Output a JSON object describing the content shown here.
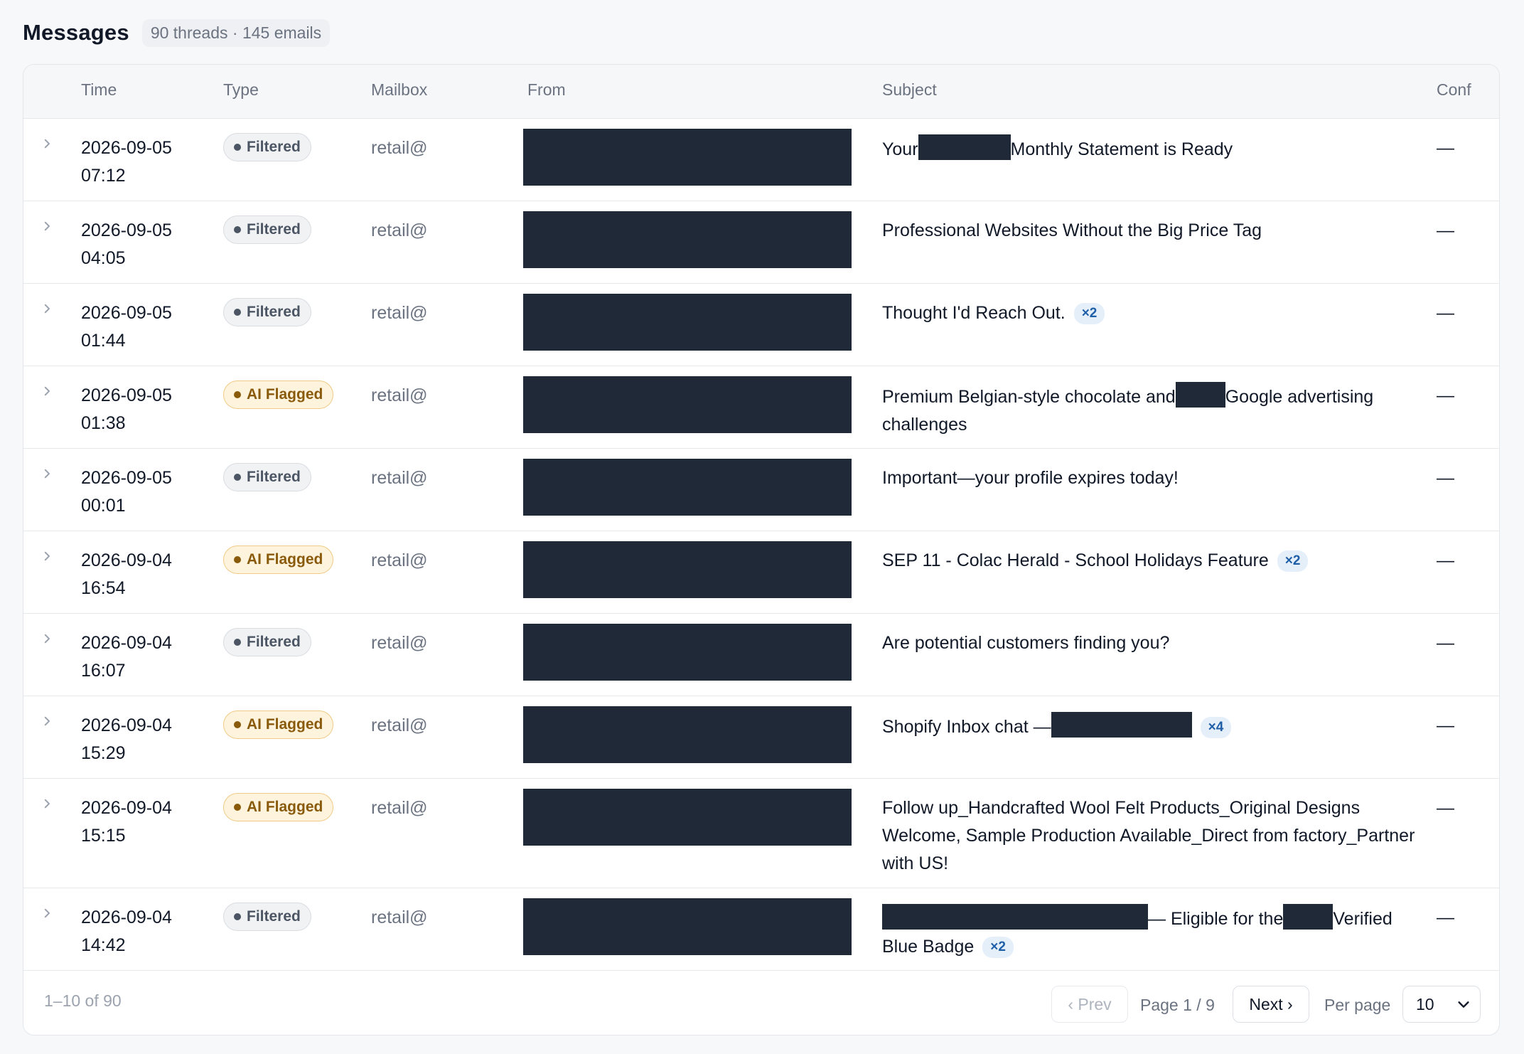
{
  "header": {
    "title": "Messages",
    "summary": "90 threads · 145 emails"
  },
  "table": {
    "columns": [
      "Time",
      "Type",
      "Mailbox",
      "From",
      "Subject",
      "Conf"
    ],
    "rows": [
      {
        "date": "2026-09-05",
        "clock": "07:12",
        "type": "Filtered",
        "mailbox": "retail@",
        "conf": "—",
        "subject": [
          {
            "t": "Your"
          },
          {
            "r": 130
          },
          {
            "t": "Monthly Statement is Ready"
          }
        ],
        "count": ""
      },
      {
        "date": "2026-09-05",
        "clock": "04:05",
        "type": "Filtered",
        "mailbox": "retail@",
        "conf": "—",
        "subject": [
          {
            "t": "Professional Websites Without the Big Price Tag"
          }
        ],
        "count": ""
      },
      {
        "date": "2026-09-05",
        "clock": "01:44",
        "type": "Filtered",
        "mailbox": "retail@",
        "conf": "—",
        "subject": [
          {
            "t": "Thought I'd Reach Out."
          }
        ],
        "count": "×2"
      },
      {
        "date": "2026-09-05",
        "clock": "01:38",
        "type": "AI Flagged",
        "mailbox": "retail@",
        "conf": "—",
        "subject": [
          {
            "t": "Premium Belgian-style chocolate and"
          },
          {
            "r": 70
          },
          {
            "t": "Google advertising challenges"
          }
        ],
        "count": ""
      },
      {
        "date": "2026-09-05",
        "clock": "00:01",
        "type": "Filtered",
        "mailbox": "retail@",
        "conf": "—",
        "subject": [
          {
            "t": "Important—your profile expires today!"
          }
        ],
        "count": ""
      },
      {
        "date": "2026-09-04",
        "clock": "16:54",
        "type": "AI Flagged",
        "mailbox": "retail@",
        "conf": "—",
        "subject": [
          {
            "t": "SEP 11 - Colac Herald - School Holidays Feature"
          }
        ],
        "count": "×2"
      },
      {
        "date": "2026-09-04",
        "clock": "16:07",
        "type": "Filtered",
        "mailbox": "retail@",
        "conf": "—",
        "subject": [
          {
            "t": "Are potential customers finding you?"
          }
        ],
        "count": ""
      },
      {
        "date": "2026-09-04",
        "clock": "15:29",
        "type": "AI Flagged",
        "mailbox": "retail@",
        "conf": "—",
        "subject": [
          {
            "t": "Shopify Inbox chat —"
          },
          {
            "r": 198
          }
        ],
        "count": "×4"
      },
      {
        "date": "2026-09-04",
        "clock": "15:15",
        "type": "AI Flagged",
        "mailbox": "retail@",
        "conf": "—",
        "subject": [
          {
            "t": "Follow up_Handcrafted Wool Felt Products_Original Designs Welcome, Sample Production Available_Direct from factory_Partner with US!"
          }
        ],
        "count": ""
      },
      {
        "date": "2026-09-04",
        "clock": "14:42",
        "type": "Filtered",
        "mailbox": "retail@",
        "conf": "—",
        "subject": [
          {
            "r": 374
          },
          {
            "t": "— Eligible for the"
          },
          {
            "r": 70
          },
          {
            "t": "Verified Blue Badge"
          }
        ],
        "count": "×2"
      }
    ]
  },
  "footer": {
    "range": "1–10 of 90",
    "prev_label": "‹ Prev",
    "page_info": "Page 1 / 9",
    "next_label": "Next ›",
    "per_page_label": "Per page",
    "per_page_value": "10"
  },
  "colors": {
    "redaction": "#1f2937",
    "filtered_badge": "#f1f2f4",
    "ai_flagged_badge": "#fef3dc",
    "count_badge": "#e5effa"
  },
  "icons": {
    "row_expand": "chevron-right-icon",
    "badge_dot": "dot-icon",
    "select_caret": "chevron-down-icon"
  }
}
